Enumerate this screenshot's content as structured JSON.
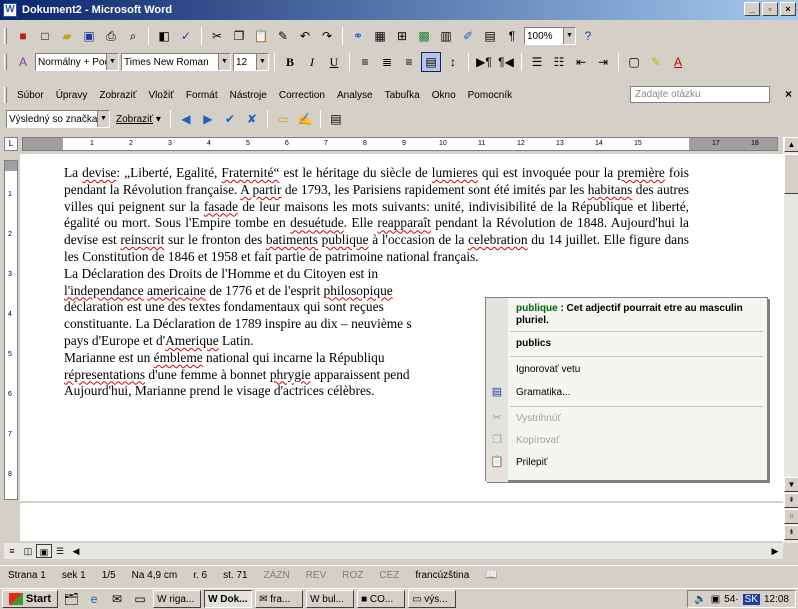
{
  "window": {
    "title": "Dokument2 - Microsoft Word",
    "controls": [
      "_",
      "▫",
      "×"
    ]
  },
  "toolbar2": {
    "zoom": "100%",
    "help_icon": "?"
  },
  "formatting": {
    "style": "Normálny + Poc",
    "font": "Times New Roman",
    "size": "12",
    "bold": "B",
    "italic": "I",
    "underline": "U"
  },
  "menu": {
    "items": [
      "Súbor",
      "Úpravy",
      "Zobraziť",
      "Vložiť",
      "Formát",
      "Nástroje",
      "Correction",
      "Analyse",
      "Tabuľka",
      "Okno",
      "Pomocník"
    ],
    "help_placeholder": "Zadajte otázku",
    "close": "×"
  },
  "reviewing": {
    "display": "Výsledný so značkam",
    "show": "Zobraziť"
  },
  "ruler": {
    "labels": [
      "1",
      "2",
      "3",
      "4",
      "5",
      "6",
      "7",
      "8",
      "9",
      "10",
      "11",
      "12",
      "13",
      "14",
      "15",
      "17",
      "18"
    ],
    "vlabels": [
      "1",
      "2",
      "3",
      "4",
      "5",
      "6",
      "7",
      "8"
    ]
  },
  "document": {
    "p1a": "La ",
    "w_devise": "devise",
    "p1b": ": „Liberté, Egalité, ",
    "w_fraternite": "Fraternité“",
    "p1c": " est le héritage du siècle de ",
    "w_lumieres": "lumieres",
    "p1d": " qui est invoquée pour la ",
    "w_premiere": "première",
    "p1e": " fois pendant la Révolution française. ",
    "w_apartir": "A partir",
    "p1f": " de 1793, les Parisiens rapidement sont été imités par les ",
    "w_habitans": "habitans",
    "p1g": " des autres villes qui peignent sur la ",
    "w_fasade": "fasade",
    "p1h": " de leur maisons les mots suivants: unité, indivisibilité de la République et liberté, égalité ou mort. Sous l'Empire tombe en ",
    "w_desuetude": "desuétude",
    "p1i": ". Elle ",
    "w_reapparait": "reapparaît",
    "p1j": " pendant la Révolution de 1848. Aujourd'hui la devise est ",
    "w_reinscrit": "reinscrit",
    "p1k": " sur le fronton des ",
    "w_batiments": "batiments",
    "p1l": " ",
    "w_publique": "publique",
    "p1m": " à l'occasion de la ",
    "w_celebration": "celebration",
    "p1n": " du 14 juillet. Elle figure dans les Constitution de 1846 et 1958 et fait partie de patrimoine national français.",
    "p2a": "La Déclaration des Droits de l'Homme et du Citoyen est in",
    "w_independance": "l'independance",
    "p2sp": " ",
    "w_americaine": "americaine",
    "p2b": " de 1776 et de l'esprit ",
    "w_philosopique": "philosopique",
    "p2c": "déclaration est une des textes fondamentaux qui sont reçues",
    "p2d": "constituante. La Déclaration de 1789 inspire au dix – neuvième s",
    "p2e": "pays d'Europe et d'",
    "w_amerique": "Amerique",
    "p2f": " Latin.",
    "p3a": "Marianne est un ",
    "w_embleme": "émbleme",
    "p3b": " national qui incarne la Républiqu",
    "w_representations": "répresentations",
    "p3c": " d'une femme à bonnet ",
    "w_phrygie": "phrygie",
    "p3d": " apparaissent pend",
    "p3e": "Aujourd'hui, Marianne prend le visage d'actrices célèbres."
  },
  "context_menu": {
    "header_word": "publique",
    "header_msg": " : Cet adjectif pourrait etre au masculin pluriel.",
    "suggestion": "publics",
    "ignore": "Ignorovať vetu",
    "grammar": "Gramatika...",
    "cut": "Vystrihnúť",
    "copy": "Kopírovať",
    "paste": "Prilepiť"
  },
  "status": {
    "page": "Strana 1",
    "section": "sek 1",
    "pages": "1/5",
    "at": "Na 4,9 cm",
    "line": "r. 6",
    "col": "st. 71",
    "rec": "ZÁZN",
    "rev": "REV",
    "ext": "ROZ",
    "ovr": "CEZ",
    "lang": "francúzština"
  },
  "taskbar": {
    "start": "Start",
    "tasks": [
      "riga...",
      "Dok...",
      "fra...",
      "bul...",
      "CO...",
      "výs..."
    ],
    "clock": "12:08",
    "tray_text": "54·",
    "lang": "SK"
  },
  "icons": [
    "word-icon",
    "new-icon",
    "open-icon",
    "save-icon",
    "print-icon",
    "preview-icon",
    "spell-icon",
    "cut-icon",
    "copy-icon",
    "paste-icon",
    "undo-icon",
    "redo-icon",
    "table-icon",
    "zoom-icon",
    "help-icon",
    "bold-icon",
    "italic-icon",
    "underline-icon",
    "align-icon",
    "bullets-icon",
    "indent-icon",
    "border-icon",
    "highlight-icon",
    "font-color-icon",
    "grammar-icon",
    "cut-menu-icon",
    "copy-menu-icon",
    "paste-menu-icon"
  ]
}
